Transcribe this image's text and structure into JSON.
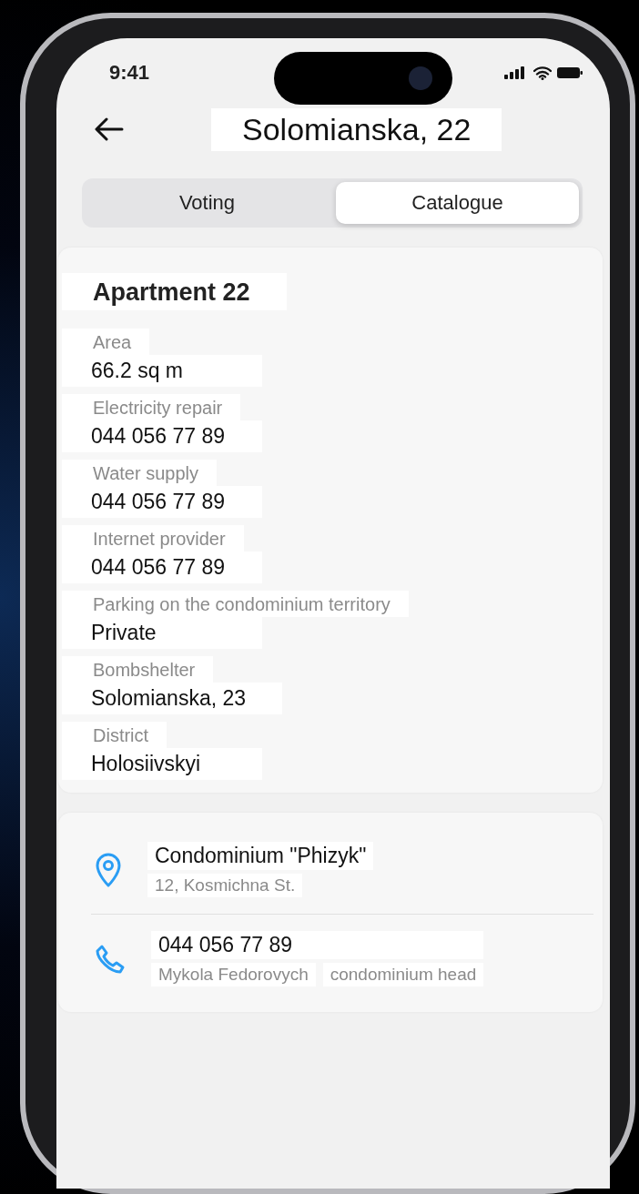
{
  "status_bar": {
    "time": "9:41"
  },
  "header": {
    "title": "Solomianska, 22"
  },
  "tabs": [
    {
      "label": "Voting",
      "selected": false
    },
    {
      "label": "Catalogue",
      "selected": true
    }
  ],
  "apartment": {
    "title": "Apartment 22",
    "fields": [
      {
        "label": "Area",
        "value": "66.2 sq m"
      },
      {
        "label": "Electricity repair",
        "value": "044 056 77 89"
      },
      {
        "label": "Water supply",
        "value": "044 056 77 89"
      },
      {
        "label": "Internet provider",
        "value": "044 056 77 89"
      },
      {
        "label": "Parking on the condominium territory",
        "value": "Private"
      },
      {
        "label": "Bombshelter",
        "value": "Solomianska, 23"
      },
      {
        "label": "District",
        "value": "Holosiivskyi"
      }
    ]
  },
  "contacts": [
    {
      "kind": "location",
      "title": "Condominium \"Phizyk\"",
      "subtitle": "12, Kosmichna St."
    },
    {
      "kind": "phone",
      "title": "044 056 77 89",
      "subtitle": "Mykola Fedorovych",
      "note": "condominium head"
    }
  ]
}
